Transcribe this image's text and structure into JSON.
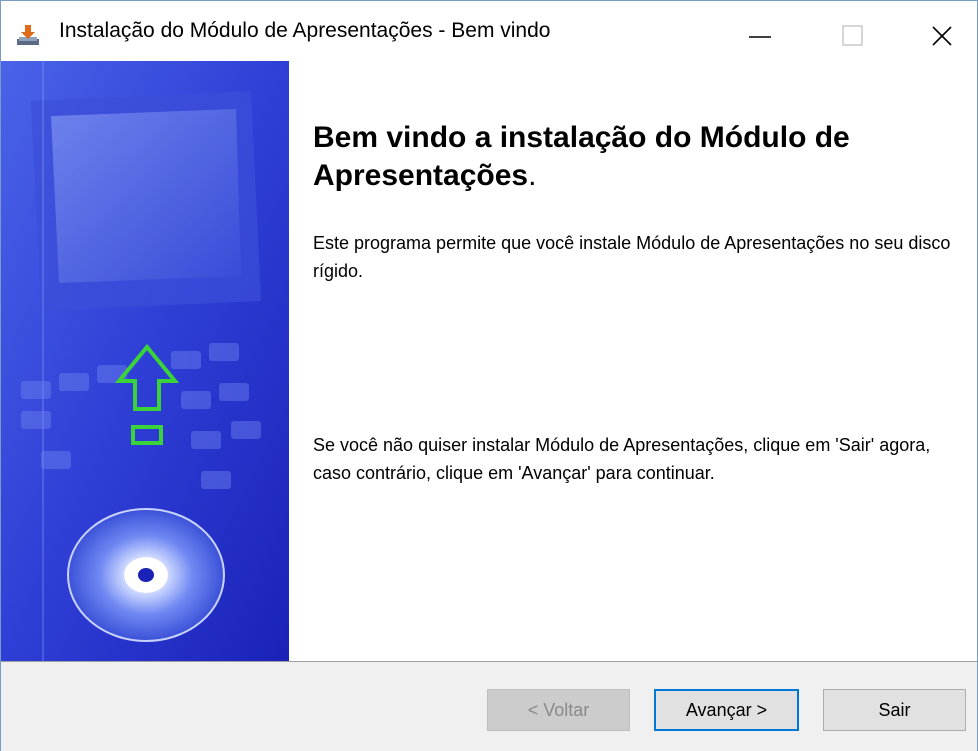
{
  "window": {
    "title": "Instalação do Módulo de Apresentações - Bem vindo"
  },
  "content": {
    "heading_main": "Bem vindo a instalação do  Módulo de Apresentações",
    "heading_dot": ".",
    "paragraph1": "Este programa permite que você instale Módulo de Apresentações no seu disco rígido.",
    "paragraph2": "Se você não quiser instalar Módulo de Apresentações, clique em 'Sair' agora, caso contrário, clique em 'Avançar' para continuar."
  },
  "footer": {
    "back_label": "< Voltar",
    "next_label": "Avançar >",
    "exit_label": "Sair"
  },
  "icons": {
    "app": "installer-icon",
    "minimize": "minimize-icon",
    "maximize": "maximize-icon",
    "close": "close-icon",
    "banner_arrow": "up-arrow-icon",
    "banner_disc": "cd-disc-icon"
  },
  "colors": {
    "banner_blue": "#2b2bc8",
    "arrow_green": "#3ad43a",
    "focus_border": "#0078d7"
  }
}
